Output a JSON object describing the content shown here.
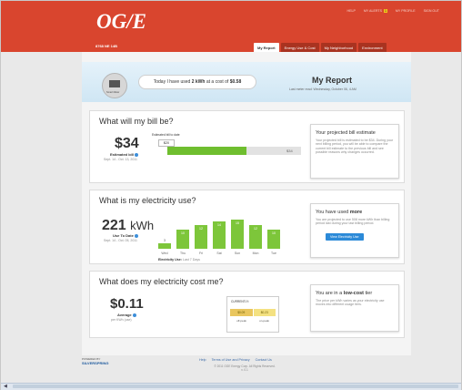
{
  "header": {
    "logo": "OG/E",
    "top_links": [
      "HELP",
      "MY ALERTS",
      "MY PROFILE",
      "SIGN OUT"
    ],
    "alerts_count": "1",
    "account_id": "8768 NE 14B",
    "tabs": [
      "My Report",
      "Energy Use & Cost",
      "My Neighborhood",
      "Environment"
    ],
    "active_tab_index": 0
  },
  "hero": {
    "meter_label": "Smart Meter",
    "today_prefix": "Today I have used ",
    "today_kwh": "2 kWh",
    "today_mid": " at a cost of ",
    "today_cost": "$0.58",
    "title": "My Report",
    "last_read": "Last meter read: Wednesday, October 06, 4 AM"
  },
  "bill": {
    "question": "What will my bill be?",
    "amount": "$34",
    "label": "Estimated bill",
    "dates": "Sept. 14 - Oct. 13, 2011",
    "to_date_label": "Estimated bill to date",
    "to_date_value": "$20",
    "bar_end_value": "$34",
    "progress_fraction": 0.59,
    "side_title": "Your projected bill estimate",
    "side_text": "Your projected bill is estimated to be $34. During your next billing period, you will be able to compare the current bill estimate to the previous bill and see possible reasons why changes occurred."
  },
  "usage": {
    "question": "What is my electricity use?",
    "amount": "221",
    "unit": "kWh",
    "label": "Use To Date",
    "dates": "Sept. 14 - Oct. 05, 2011",
    "chart_caption": "Electricity Use",
    "chart_caption_range": "Last 7 Days",
    "side_title_prefix": "You have used ",
    "side_title_emphasis": "more",
    "side_text": "You are projected to use 508 more kWh than billing period last during your last billing period.",
    "side_button": "View Electricity Use"
  },
  "cost": {
    "question": "What does my electricity cost me?",
    "amount": "$0.11",
    "label": "Average",
    "per": "per KWh (use)",
    "box_head": "CURRENTLY:",
    "cells": [
      "$0.09",
      "$0.23"
    ],
    "cell_labels": [
      "off-peak",
      "on-peak"
    ],
    "side_title_prefix": "You are in a ",
    "side_title_emphasis": "low-cost",
    "side_title_suffix": " tier",
    "side_text": "The price per kWh varies as your electricity use moves into different usage tiers."
  },
  "footer": {
    "powered_by": "POWERED BY",
    "brand": "SILVERSPRING",
    "links": [
      "Help",
      "Terms of Use and Privacy",
      "Contact Us"
    ],
    "copyright": "© 2011 OGE Energy Corp. All Rights Reserved.",
    "version": "v. 0.1"
  },
  "chart_data": {
    "type": "bar",
    "categories": [
      "Wed",
      "Thu",
      "Fri",
      "Sat",
      "Sun",
      "Mon",
      "Tue"
    ],
    "values": [
      3,
      10,
      12,
      14,
      15,
      12,
      10
    ],
    "ylim": [
      0,
      16
    ],
    "title": "",
    "xlabel": "Electricity Use",
    "ylabel": "",
    "grid": false,
    "bar_color": "#7dc63a"
  },
  "colors": {
    "brand": "#d9452e",
    "accent_green": "#7dc63a",
    "link_blue": "#2c8ad8"
  }
}
